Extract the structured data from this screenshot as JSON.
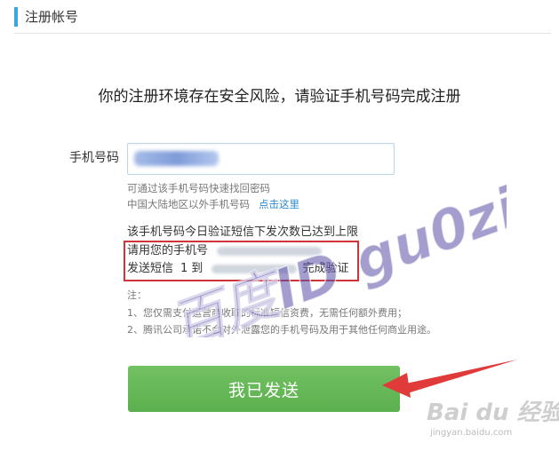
{
  "header": {
    "title": "注册帐号"
  },
  "main": {
    "title": "你的注册环境存在安全风险，请验证手机号码完成注册"
  },
  "form": {
    "phone_label": "手机号码",
    "phone_value": "",
    "hint_recover": "可通过该手机号码快速找回密码",
    "hint_foreign": "中国大陆地区以外手机号码",
    "hint_foreign_link": "点击这里"
  },
  "verify": {
    "limit_notice": "该手机号码今日验证短信下发次数已达到上限",
    "line1_prefix": "请用您的手机号",
    "line2_prefix": "发送短信",
    "line2_code": "1",
    "line2_to": "到",
    "line2_suffix": "完成验证"
  },
  "notes": {
    "title": "注：",
    "items": [
      "1、您仅需支付运营商收取的标准短信资费，无需任何额外费用；",
      "2、腾讯公司承诺不会对外泄露您的手机号码及用于其他任何商业用途。"
    ]
  },
  "actions": {
    "sent_button": "我已发送"
  },
  "watermark": {
    "text": "百度ID gu0zi",
    "baidu_logo": "Bai du 经验",
    "baidu_url": "jingyan.baidu.com"
  },
  "colors": {
    "accent_blue": "#3aa5e0",
    "link_blue": "#2d8bd1",
    "button_green": "#5caf4e",
    "highlight_red": "#d0343b",
    "watermark_purple": "#5a4fa8"
  }
}
